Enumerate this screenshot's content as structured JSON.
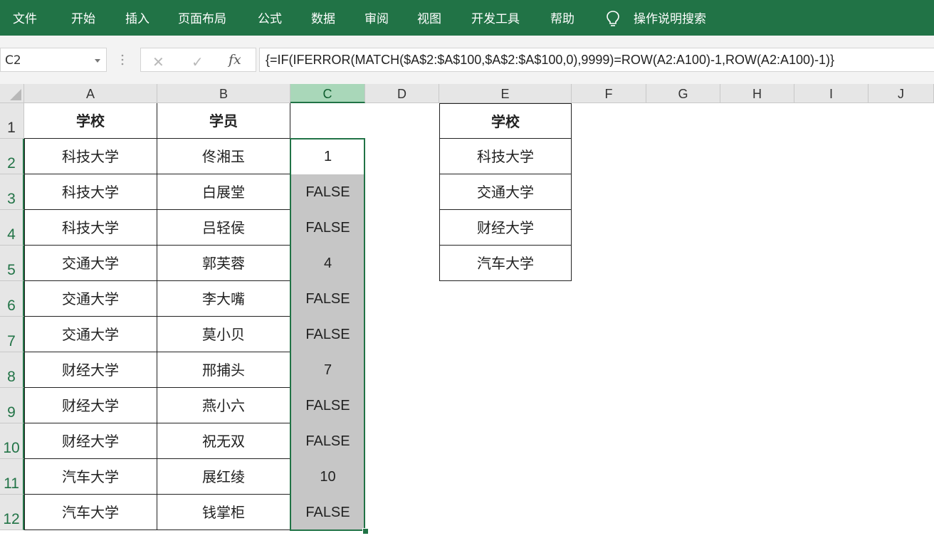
{
  "ribbon": {
    "tabs": [
      "文件",
      "开始",
      "插入",
      "页面布局",
      "公式",
      "数据",
      "审阅",
      "视图",
      "开发工具",
      "帮助"
    ],
    "search_label": "操作说明搜索"
  },
  "formula_bar": {
    "name_box": "C2",
    "cancel_icon": "✕",
    "enter_icon": "✓",
    "fx_label": "fx",
    "formula": "{=IF(IFERROR(MATCH($A$2:$A$100,$A$2:$A$100,0),9999)=ROW(A2:A100)-1,ROW(A2:A100)-1)}"
  },
  "grid": {
    "columns": [
      "A",
      "B",
      "C",
      "D",
      "E",
      "F",
      "G",
      "H",
      "I",
      "J"
    ],
    "rows": [
      "1",
      "2",
      "3",
      "4",
      "5",
      "6",
      "7",
      "8",
      "9",
      "10",
      "11",
      "12"
    ],
    "selected_column": "C",
    "header_school": "学校",
    "header_student": "学员",
    "schools": [
      "科技大学",
      "科技大学",
      "科技大学",
      "交通大学",
      "交通大学",
      "交通大学",
      "财经大学",
      "财经大学",
      "财经大学",
      "汽车大学",
      "汽车大学"
    ],
    "students": [
      "佟湘玉",
      "白展堂",
      "吕轻侯",
      "郭芙蓉",
      "李大嘴",
      "莫小贝",
      "邢捕头",
      "燕小六",
      "祝无双",
      "展红绫",
      "钱掌柜"
    ],
    "results": [
      "1",
      "FALSE",
      "FALSE",
      "4",
      "FALSE",
      "FALSE",
      "7",
      "FALSE",
      "FALSE",
      "10",
      "FALSE"
    ],
    "unique_header": "学校",
    "unique_schools": [
      "科技大学",
      "交通大学",
      "财经大学",
      "汽车大学"
    ]
  },
  "colors": {
    "ribbon": "#217346",
    "selection_fill": "#c6c6c6",
    "selected_header": "#a9d7b9"
  }
}
